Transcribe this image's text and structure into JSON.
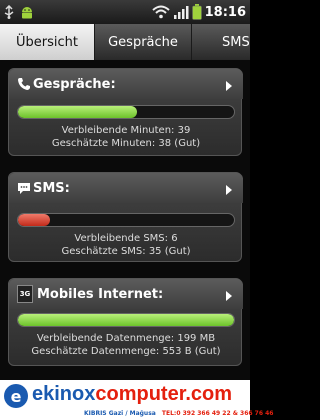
{
  "status": {
    "time": "18:16",
    "icons": [
      "usb-icon",
      "android-icon",
      "wifi-icon",
      "signal-icon",
      "battery-icon"
    ]
  },
  "tabs": [
    {
      "label": "Übersicht",
      "active": true
    },
    {
      "label": "Gespräche",
      "active": false
    },
    {
      "label": "SMS",
      "active": false
    }
  ],
  "cards": {
    "calls": {
      "title": "Gespräche:",
      "icon": "phone-icon",
      "progress": 0.55,
      "color": "green",
      "line1": "Verbleibende Minuten: 39",
      "line2": "Geschätzte Minuten: 38 (Gut)"
    },
    "sms": {
      "title": "SMS:",
      "icon": "sms-icon",
      "progress": 0.15,
      "color": "red",
      "line1": "Verbleibende SMS: 6",
      "line2": "Geschätzte SMS: 35 (Gut)"
    },
    "internet": {
      "title": "Mobiles Internet:",
      "icon": "3g-icon",
      "icon_text": "3G",
      "progress": 1.0,
      "color": "green",
      "line1": "Verbleibende Datenmenge: 199 MB",
      "line2": "Geschätzte Datenmenge: 553 B (Gut)"
    }
  },
  "footer": {
    "logo_part1": "ekinox",
    "logo_part2": "computer.com",
    "address": "KIBRIS Gazi / Mağusa",
    "phone": "TEL:0 392 366 49 22 & 366 76 46"
  }
}
